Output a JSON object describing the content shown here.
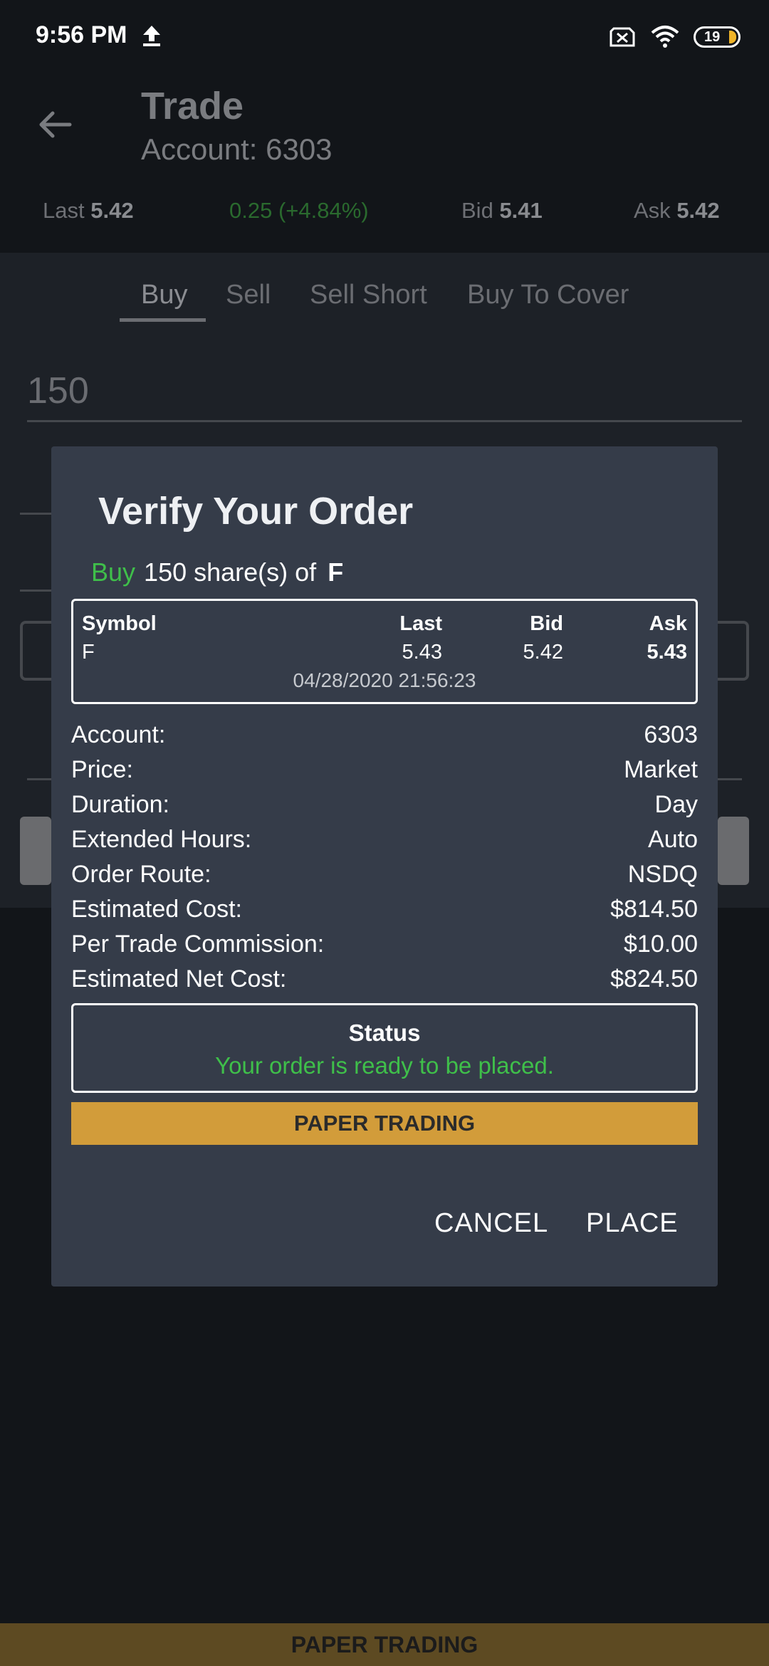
{
  "status_bar": {
    "time": "9:56 PM",
    "battery": "19"
  },
  "header": {
    "title": "Trade",
    "account_line": "Account: 6303"
  },
  "quote": {
    "last_label": "Last",
    "last_value": "5.42",
    "change": "0.25 (+4.84%)",
    "bid_label": "Bid",
    "bid_value": "5.41",
    "ask_label": "Ask",
    "ask_value": "5.42"
  },
  "tabs": [
    "Buy",
    "Sell",
    "Sell Short",
    "Buy To Cover"
  ],
  "quantity": "150",
  "dialog": {
    "title": "Verify Your Order",
    "side": "Buy",
    "summary": "150 share(s) of",
    "symbol": "F",
    "quote_table": {
      "headers": [
        "Symbol",
        "Last",
        "Bid",
        "Ask"
      ],
      "row": [
        "F",
        "5.43",
        "5.42",
        "5.43"
      ],
      "timestamp": "04/28/2020 21:56:23"
    },
    "details": [
      {
        "label": "Account:",
        "value": "6303"
      },
      {
        "label": "Price:",
        "value": "Market"
      },
      {
        "label": "Duration:",
        "value": "Day"
      },
      {
        "label": "Extended Hours:",
        "value": "Auto"
      },
      {
        "label": "Order Route:",
        "value": "NSDQ"
      },
      {
        "label": "Estimated Cost:",
        "value": "$814.50"
      },
      {
        "label": "Per Trade Commission:",
        "value": "$10.00"
      },
      {
        "label": "Estimated Net Cost:",
        "value": "$824.50"
      }
    ],
    "status_title": "Status",
    "status_message": "Your order is ready to be placed.",
    "paper_trading": "PAPER TRADING",
    "cancel_label": "CANCEL",
    "place_label": "PLACE"
  },
  "bottom_banner": "PAPER TRADING",
  "colors": {
    "accent_green": "#3fbf4a",
    "paper_banner": "#d29c3a",
    "dialog_bg": "#353c49"
  }
}
